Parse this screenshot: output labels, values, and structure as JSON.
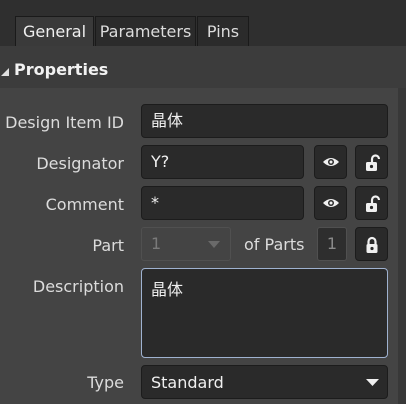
{
  "tabs": [
    "General",
    "Parameters",
    "Pins"
  ],
  "section": {
    "title": "Properties"
  },
  "fields": {
    "design_item_id": {
      "label": "Design Item ID",
      "value": "晶体"
    },
    "designator": {
      "label": "Designator",
      "value": "Y?"
    },
    "comment": {
      "label": "Comment",
      "value": "*"
    },
    "part": {
      "label": "Part",
      "value": "1",
      "of_parts_label": "of Parts",
      "count": "1"
    },
    "description": {
      "label": "Description",
      "value": "晶体"
    },
    "type": {
      "label": "Type",
      "value": "Standard"
    }
  },
  "icons": [
    "eye-icon",
    "unlock-icon",
    "lock-icon",
    "chevron-down-icon",
    "collapse-triangle-icon"
  ],
  "colors": {
    "panel": "#444444",
    "header": "#2f2f2f",
    "field": "#2a2a2a",
    "focus_border": "#9fb2d0"
  }
}
